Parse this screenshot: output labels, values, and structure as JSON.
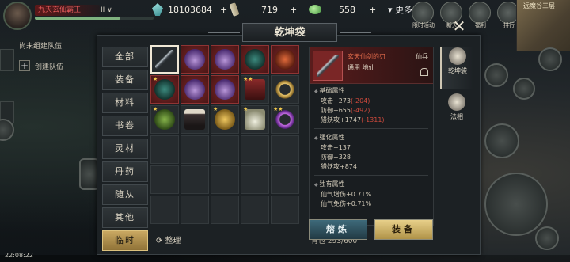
{
  "top": {
    "player_name": "九天玄仙霸王",
    "player_indicator": "II ∨",
    "hp_fraction": 0.72,
    "currencies": [
      {
        "icon": "spirit-gem-icon",
        "amount": "18103684"
      },
      {
        "icon": "scroll-icon",
        "amount": "719"
      },
      {
        "icon": "jade-icon",
        "amount": "558"
      }
    ],
    "more_label": "▾ 更多",
    "icons": [
      {
        "icon": "limited-event-icon",
        "label": "限时活动"
      },
      {
        "icon": "new-icon",
        "label": "新天"
      },
      {
        "icon": "welfare-icon",
        "label": "福利"
      },
      {
        "icon": "ranking-icon",
        "label": "排行"
      }
    ],
    "minimap_label": "远魔谷三层"
  },
  "team": {
    "no_team": "尚未组建队伍",
    "create_team": "创建队伍"
  },
  "clock": "22:08:22",
  "bag": {
    "title": "乾坤袋",
    "categories": [
      "全部",
      "装备",
      "材料",
      "书卷",
      "灵材",
      "丹药",
      "随从",
      "其他",
      "临时"
    ],
    "active_category": 8,
    "items": [
      {
        "kind": "sword",
        "red": false,
        "selected": true,
        "stars": ""
      },
      {
        "kind": "mask",
        "red": true,
        "stars": ""
      },
      {
        "kind": "mask",
        "red": true,
        "stars": ""
      },
      {
        "kind": "teal",
        "red": true,
        "stars": ""
      },
      {
        "kind": "fire",
        "red": true,
        "stars": ""
      },
      {
        "kind": "teal",
        "red": true,
        "stars": "★"
      },
      {
        "kind": "mask",
        "red": true,
        "stars": ""
      },
      {
        "kind": "mask",
        "red": true,
        "stars": ""
      },
      {
        "kind": "boots",
        "red": false,
        "stars": "★★"
      },
      {
        "kind": "ring",
        "red": false,
        "stars": ""
      },
      {
        "kind": "disc",
        "red": false,
        "stars": "★"
      },
      {
        "kind": "slab",
        "red": false,
        "stars": ""
      },
      {
        "kind": "gold",
        "red": false,
        "stars": "★"
      },
      {
        "kind": "bell",
        "red": false,
        "stars": "★"
      },
      {
        "kind": "purp",
        "red": false,
        "stars": "★★"
      }
    ],
    "total_slots": 30,
    "tidy_label": "整理",
    "capacity": "背包 293/600",
    "detail": {
      "name": "玄天仙剑的刃",
      "tier": "仙兵",
      "use": "通用 地仙",
      "base_title": "基础属性",
      "base": [
        {
          "text": "攻击+273",
          "neg": "(-204)"
        },
        {
          "text": "防御+655",
          "neg": "(-492)"
        },
        {
          "text": "猎妖攻+1747",
          "neg": "(-1311)"
        }
      ],
      "enh_title": "强化属性",
      "enh": [
        "攻击+137",
        "防御+328",
        "猎妖攻+874"
      ],
      "unique_title": "独有属性",
      "unique": [
        "仙气增伤+0.71%",
        "仙气免伤+0.71%"
      ]
    },
    "refine_label": "熔炼",
    "equip_label": "装备",
    "right_tabs": [
      {
        "icon": "qiankun-bag-icon",
        "label": "乾坤袋"
      },
      {
        "icon": "magic-treasure-icon",
        "label": "法相"
      }
    ]
  }
}
